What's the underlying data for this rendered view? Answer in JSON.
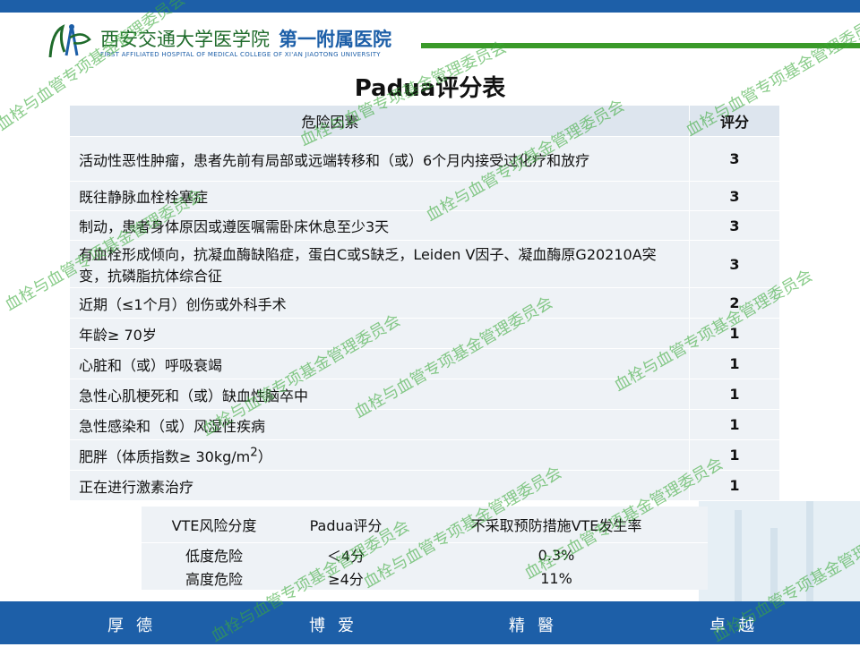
{
  "header": {
    "hospital_cn_prefix": "西安交通大学医学院",
    "hospital_cn_main": "第一附属医院",
    "hospital_en": "FIRST AFFILIATED HOSPITAL OF MEDICAL COLLEGE OF XI'AN JIAOTONG UNIVERSITY"
  },
  "title": "Padua评分表",
  "table": {
    "headers": [
      "危险因素",
      "评分"
    ],
    "rows": [
      {
        "factor": "活动性恶性肿瘤，患者先前有局部或远端转移和（或）6个月内接受过化疗和放疗",
        "score": "3"
      },
      {
        "factor": "既往静脉血栓栓塞症",
        "score": "3"
      },
      {
        "factor": "制动，患者身体原因或遵医嘱需卧床休息至少3天",
        "score": "3"
      },
      {
        "factor": "有血栓形成倾向，抗凝血酶缺陷症，蛋白C或S缺乏，Leiden V因子、凝血酶原G20210A突变，抗磷脂抗体综合征",
        "score": "3"
      },
      {
        "factor": "近期（≤1个月）创伤或外科手术",
        "score": "2"
      },
      {
        "factor": "年龄≥ 70岁",
        "score": "1"
      },
      {
        "factor": "心脏和（或）呼吸衰竭",
        "score": "1"
      },
      {
        "factor": "急性心肌梗死和（或）缺血性脑卒中",
        "score": "1"
      },
      {
        "factor": "急性感染和（或）风湿性疾病",
        "score": "1"
      },
      {
        "factor_prefix": "肥胖（体质指数≥ 30kg/m",
        "factor_sup": "2",
        "factor_suffix": "）",
        "score": "1"
      },
      {
        "factor": "正在进行激素治疗",
        "score": "1"
      }
    ]
  },
  "risk_table": {
    "headers": [
      "VTE风险分度",
      "Padua评分",
      "不采取预防措施VTE发生率"
    ],
    "rows": [
      {
        "level": "低度危险",
        "score": "＜4分",
        "rate": "0.3%"
      },
      {
        "level": "高度危险",
        "score": "≥4分",
        "rate": "11%"
      }
    ]
  },
  "footer": {
    "motto": [
      "厚德",
      "博爱",
      "精醫",
      "卓越"
    ]
  },
  "watermark": "血栓与血管专项基金管理委员会",
  "colors": {
    "brand_blue": "#1d5fa8",
    "brand_green": "#3a9a2a",
    "table_bg": "#eef2f6",
    "watermark": "#3caa3c"
  }
}
